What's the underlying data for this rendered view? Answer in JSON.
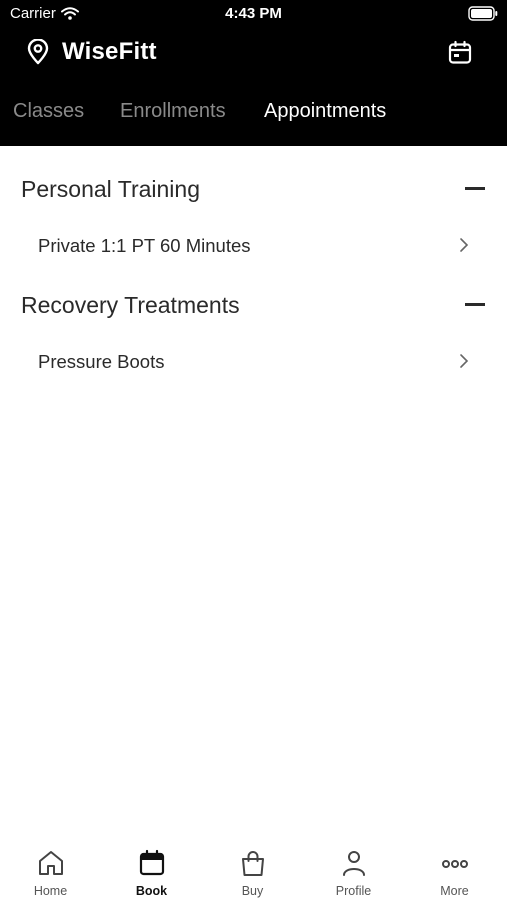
{
  "status_bar": {
    "carrier": "Carrier",
    "time": "4:43 PM"
  },
  "app": {
    "title": "WiseFitt",
    "location_icon": "map-pin-icon",
    "calendar_icon": "calendar-icon"
  },
  "tabs": [
    {
      "label": "Classes",
      "active": false
    },
    {
      "label": "Enrollments",
      "active": false
    },
    {
      "label": "Appointments",
      "active": true
    }
  ],
  "sections": [
    {
      "title": "Personal Training",
      "items": [
        "Private 1:1 PT 60 Minutes"
      ]
    },
    {
      "title": "Recovery Treatments",
      "items": [
        "Pressure Boots"
      ]
    }
  ],
  "bottom_nav": [
    {
      "label": "Home",
      "icon": "home-icon",
      "active": false
    },
    {
      "label": "Book",
      "icon": "calendar-icon",
      "active": true
    },
    {
      "label": "Buy",
      "icon": "shopping-bag-icon",
      "active": false
    },
    {
      "label": "Profile",
      "icon": "person-icon",
      "active": false
    },
    {
      "label": "More",
      "icon": "more-dots-icon",
      "active": false
    }
  ],
  "colors": {
    "header_bg": "#000000",
    "tab_inactive": "#8a8a8a",
    "tab_active": "#ffffff"
  }
}
